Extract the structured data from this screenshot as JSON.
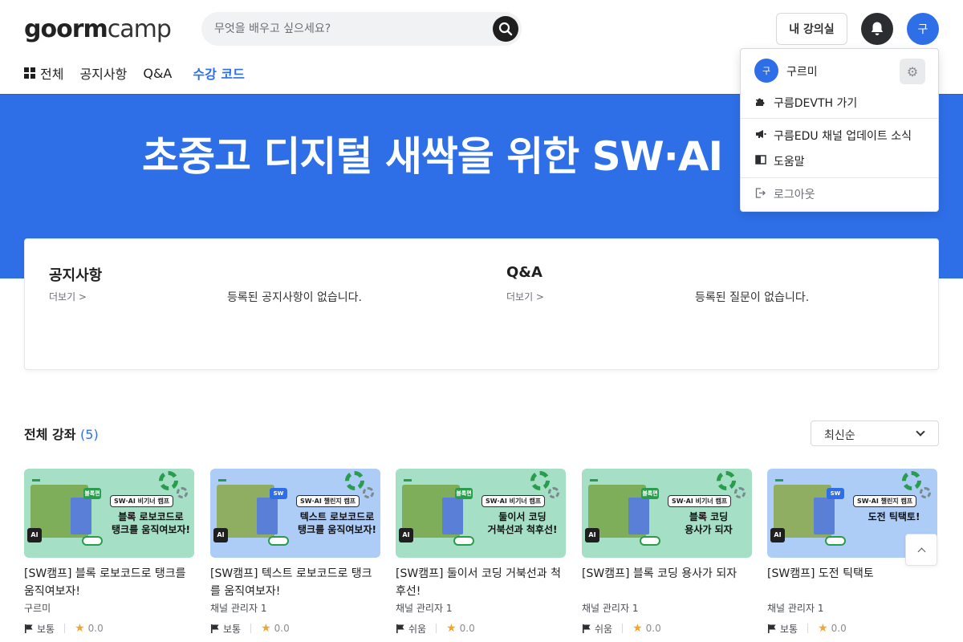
{
  "header": {
    "logo": {
      "part1": "goorm",
      "part2": "camp"
    },
    "search_placeholder": "무엇을 배우고 싶으세요?",
    "my_courses_label": "내 강의실",
    "avatar_initial": "구"
  },
  "nav": {
    "items": [
      {
        "label": "전체"
      },
      {
        "label": "공지사항"
      },
      {
        "label": "Q&A"
      },
      {
        "label": "수강 코드"
      }
    ]
  },
  "banner": {
    "title": "초중고 디지털 새싹을 위한 SW·AI"
  },
  "board": {
    "notice": {
      "title": "공지사항",
      "more": "더보기  >",
      "empty": "등록된 공지사항이 없습니다."
    },
    "qna": {
      "title": "Q&A",
      "more": "더보기  >",
      "empty": "등록된 질문이 없습니다."
    }
  },
  "courses": {
    "heading": "전체 강좌",
    "count": "(5)",
    "sort_selected": "최신순",
    "items": [
      {
        "title": "[SW캠프] 블록 로보코드로 탱크를 움직여보자!",
        "author": "구르미",
        "level": "보통",
        "rating": "0.0",
        "thumb": {
          "bg": "#a5dfc6",
          "kind": "블록편",
          "kind_color": "#2a9c4e",
          "tag": "SW·AI 비기너 캠프",
          "headline": "블록 로보코드로\n탱크를 움직여보자!"
        }
      },
      {
        "title": "[SW캠프] 텍스트 로보코드로 탱크를 움직여보자!",
        "author": "채널 관리자 1",
        "level": "보통",
        "rating": "0.0",
        "thumb": {
          "bg": "#aecdf6",
          "kind": "SW",
          "kind_color": "#2e6fe8",
          "tag": "SW·AI 챌린지 캠프",
          "headline": "텍스트 로보코드로\n탱크를 움직여보자!"
        }
      },
      {
        "title": "[SW캠프] 둘이서 코딩 거북선과 척후선!",
        "author": "채널 관리자 1",
        "level": "쉬움",
        "rating": "0.0",
        "thumb": {
          "bg": "#a5dfc6",
          "kind": "블록편",
          "kind_color": "#2a9c4e",
          "tag": "SW·AI 비기너 캠프",
          "headline": "둘이서 코딩\n거북선과 척후선!"
        }
      },
      {
        "title": "[SW캠프] 블록 코딩 용사가 되자",
        "author": "채널 관리자 1",
        "level": "쉬움",
        "rating": "0.0",
        "thumb": {
          "bg": "#a5dfc6",
          "kind": "블록편",
          "kind_color": "#2a9c4e",
          "tag": "SW·AI 비기너 캠프",
          "headline": "블록 코딩\n용사가 되자"
        }
      },
      {
        "title": "[SW캠프] 도전 틱택토",
        "author": "채널 관리자 1",
        "level": "보통",
        "rating": "0.0",
        "thumb": {
          "bg": "#aecdf6",
          "kind": "SW",
          "kind_color": "#2e6fe8",
          "tag": "SW·AI 챌린지 캠프",
          "headline": "도전 틱택토!"
        }
      }
    ]
  },
  "user_menu": {
    "avatar_initial": "구",
    "username": "구르미",
    "items": [
      {
        "label": "구름DEVTH 가기",
        "icon": "puzzle-icon"
      },
      {
        "label": "구름EDU 채널 업데이트 소식",
        "icon": "megaphone-icon"
      },
      {
        "label": "도움말",
        "icon": "book-icon"
      },
      {
        "label": "로그아웃",
        "icon": "logout-icon"
      }
    ]
  },
  "colors": {
    "brand": "#2e6fe8",
    "star": "#f2a533",
    "mint": "#a5dfc6",
    "sky": "#aecdf6"
  }
}
